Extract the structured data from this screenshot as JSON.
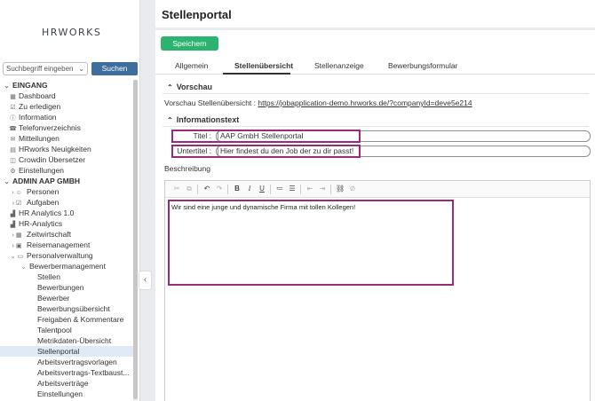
{
  "sidebar": {
    "logo_text": "HRWORKS",
    "search_placeholder": "Suchbegriff eingeben",
    "search_button": "Suchen",
    "items": [
      {
        "label": "EINGANG",
        "type": "section",
        "icon": "chevron-down-icon",
        "glyph": "⌄"
      },
      {
        "label": "Dashboard",
        "indent": 1,
        "icon": "dashboard-icon",
        "glyph": "▦"
      },
      {
        "label": "Zu erledigen",
        "indent": 1,
        "icon": "checklist-icon",
        "glyph": "☑"
      },
      {
        "label": "Information",
        "indent": 1,
        "icon": "info-icon",
        "glyph": "ⓘ"
      },
      {
        "label": "Telefonverzeichnis",
        "indent": 1,
        "icon": "phone-book-icon",
        "glyph": "☎"
      },
      {
        "label": "Mitteilungen",
        "indent": 1,
        "icon": "message-icon",
        "glyph": "✉"
      },
      {
        "label": "HRworks Neuigkeiten",
        "indent": 1,
        "icon": "news-icon",
        "glyph": "▤"
      },
      {
        "label": "Crowdin Übersetzer",
        "indent": 1,
        "icon": "translate-icon",
        "glyph": "◫"
      },
      {
        "label": "Einstellungen",
        "indent": 1,
        "icon": "gear-icon",
        "glyph": "⚙"
      },
      {
        "label": "ADMIN AAP GMBH",
        "type": "section",
        "icon": "chevron-down-icon",
        "glyph": "⌄"
      },
      {
        "label": "Personen",
        "indent": 1,
        "icon": "people-icon",
        "glyph": "› ☺"
      },
      {
        "label": "Aufgaben",
        "indent": 1,
        "icon": "tasks-icon",
        "glyph": "› ☑"
      },
      {
        "label": "HR Analytics 1.0",
        "indent": 1,
        "icon": "analytics-icon",
        "glyph": "▟"
      },
      {
        "label": "HR-Analytics",
        "indent": 1,
        "icon": "analytics-icon",
        "glyph": "▟"
      },
      {
        "label": "Zeitwirtschaft",
        "indent": 1,
        "icon": "calendar-icon",
        "glyph": "› ▦"
      },
      {
        "label": "Reisemanagement",
        "indent": 1,
        "icon": "travel-icon",
        "glyph": "› ▣"
      },
      {
        "label": "Personalverwaltung",
        "indent": 1,
        "icon": "id-card-icon",
        "glyph": "⌄ ▭"
      },
      {
        "label": "Bewerbermanagement",
        "indent": 2,
        "icon": "chevron-down-icon",
        "glyph": "⌄"
      },
      {
        "label": "Stellen",
        "indent": 3
      },
      {
        "label": "Bewerbungen",
        "indent": 3
      },
      {
        "label": "Bewerber",
        "indent": 3
      },
      {
        "label": "Bewerbungsübersicht",
        "indent": 3
      },
      {
        "label": "Freigaben & Kommentare",
        "indent": 3
      },
      {
        "label": "Talentpool",
        "indent": 3
      },
      {
        "label": "Metrikdaten-Übersicht",
        "indent": 3
      },
      {
        "label": "Stellenportal",
        "indent": 3,
        "active": true
      },
      {
        "label": "Arbeitsvertragsvorlagen",
        "indent": 3
      },
      {
        "label": "Arbeitsvertrags-Textbaust...",
        "indent": 3
      },
      {
        "label": "Arbeitsverträge",
        "indent": 3
      },
      {
        "label": "Einstellungen",
        "indent": 3
      }
    ]
  },
  "main": {
    "title": "Stellenportal",
    "save_label": "Speichern",
    "tabs": [
      "Allgemein",
      "Stellenübersicht",
      "Stellenanzeige",
      "Bewerbungsformular"
    ],
    "active_tab": 1,
    "preview": {
      "heading": "Vorschau",
      "label": "Vorschau Stellenübersicht :",
      "url": "https://jobapplication-demo.hrworks.de/?companyId=deve5e214"
    },
    "info": {
      "heading": "Informationstext",
      "title_label": "Titel :",
      "title_value": "AAP GmbH Stellenportal",
      "subtitle_label": "Untertitel :",
      "subtitle_value": "Hier findest du den Job der zu dir passt!"
    },
    "description_label": "Beschreibung",
    "editor_text": "Wir sind eine junge und dynamische Firma mit tollen Kollegen!"
  },
  "colors": {
    "accent_green": "#2bb36f",
    "search_blue": "#3d6e9e",
    "highlight_purple": "#9a2a7a",
    "active_nav": "#dfeaf6"
  }
}
